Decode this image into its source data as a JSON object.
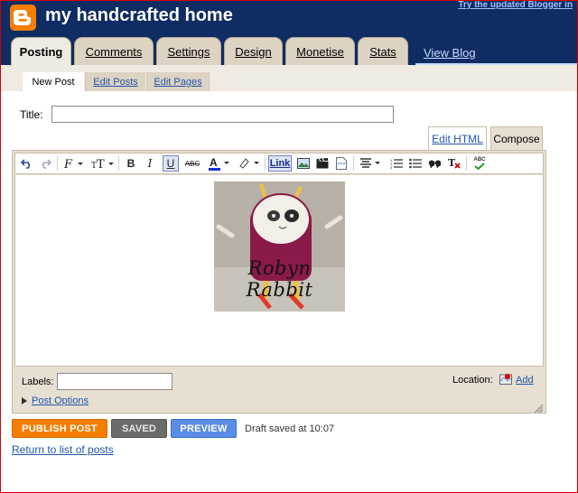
{
  "header": {
    "blog_title": "my handcrafted home",
    "top_link": "Try the updated Blogger in",
    "view_blog": "View Blog"
  },
  "tabs": [
    {
      "label": "Posting",
      "active": true
    },
    {
      "label": "Comments",
      "active": false
    },
    {
      "label": "Settings",
      "active": false
    },
    {
      "label": "Design",
      "active": false
    },
    {
      "label": "Monetise",
      "active": false
    },
    {
      "label": "Stats",
      "active": false
    }
  ],
  "subtabs": [
    {
      "label": "New Post",
      "active": true
    },
    {
      "label": "Edit Posts",
      "active": false
    },
    {
      "label": "Edit Pages",
      "active": false
    }
  ],
  "post": {
    "title_label": "Title:",
    "title_value": "",
    "mode_edit_html": "Edit HTML",
    "mode_compose": "Compose",
    "image_caption": "Robyn Rabbit"
  },
  "toolbar": {
    "bold": "B",
    "italic": "I",
    "underline": "U",
    "strike": "ABC",
    "link": "Link",
    "spellcheck": "ABC"
  },
  "footer": {
    "labels_label": "Labels:",
    "labels_value": "",
    "location_label": "Location:",
    "location_add": "Add",
    "post_options": "Post Options"
  },
  "actions": {
    "publish": "PUBLISH POST",
    "saved": "SAVED",
    "preview": "PREVIEW",
    "draft_status": "Draft saved at 10:07",
    "return_link": "Return to list of posts"
  },
  "colors": {
    "header_bg": "#0f2c63",
    "brand_orange": "#f57d00",
    "tab_bg": "#ddd3c2",
    "link_blue": "#2255aa"
  }
}
